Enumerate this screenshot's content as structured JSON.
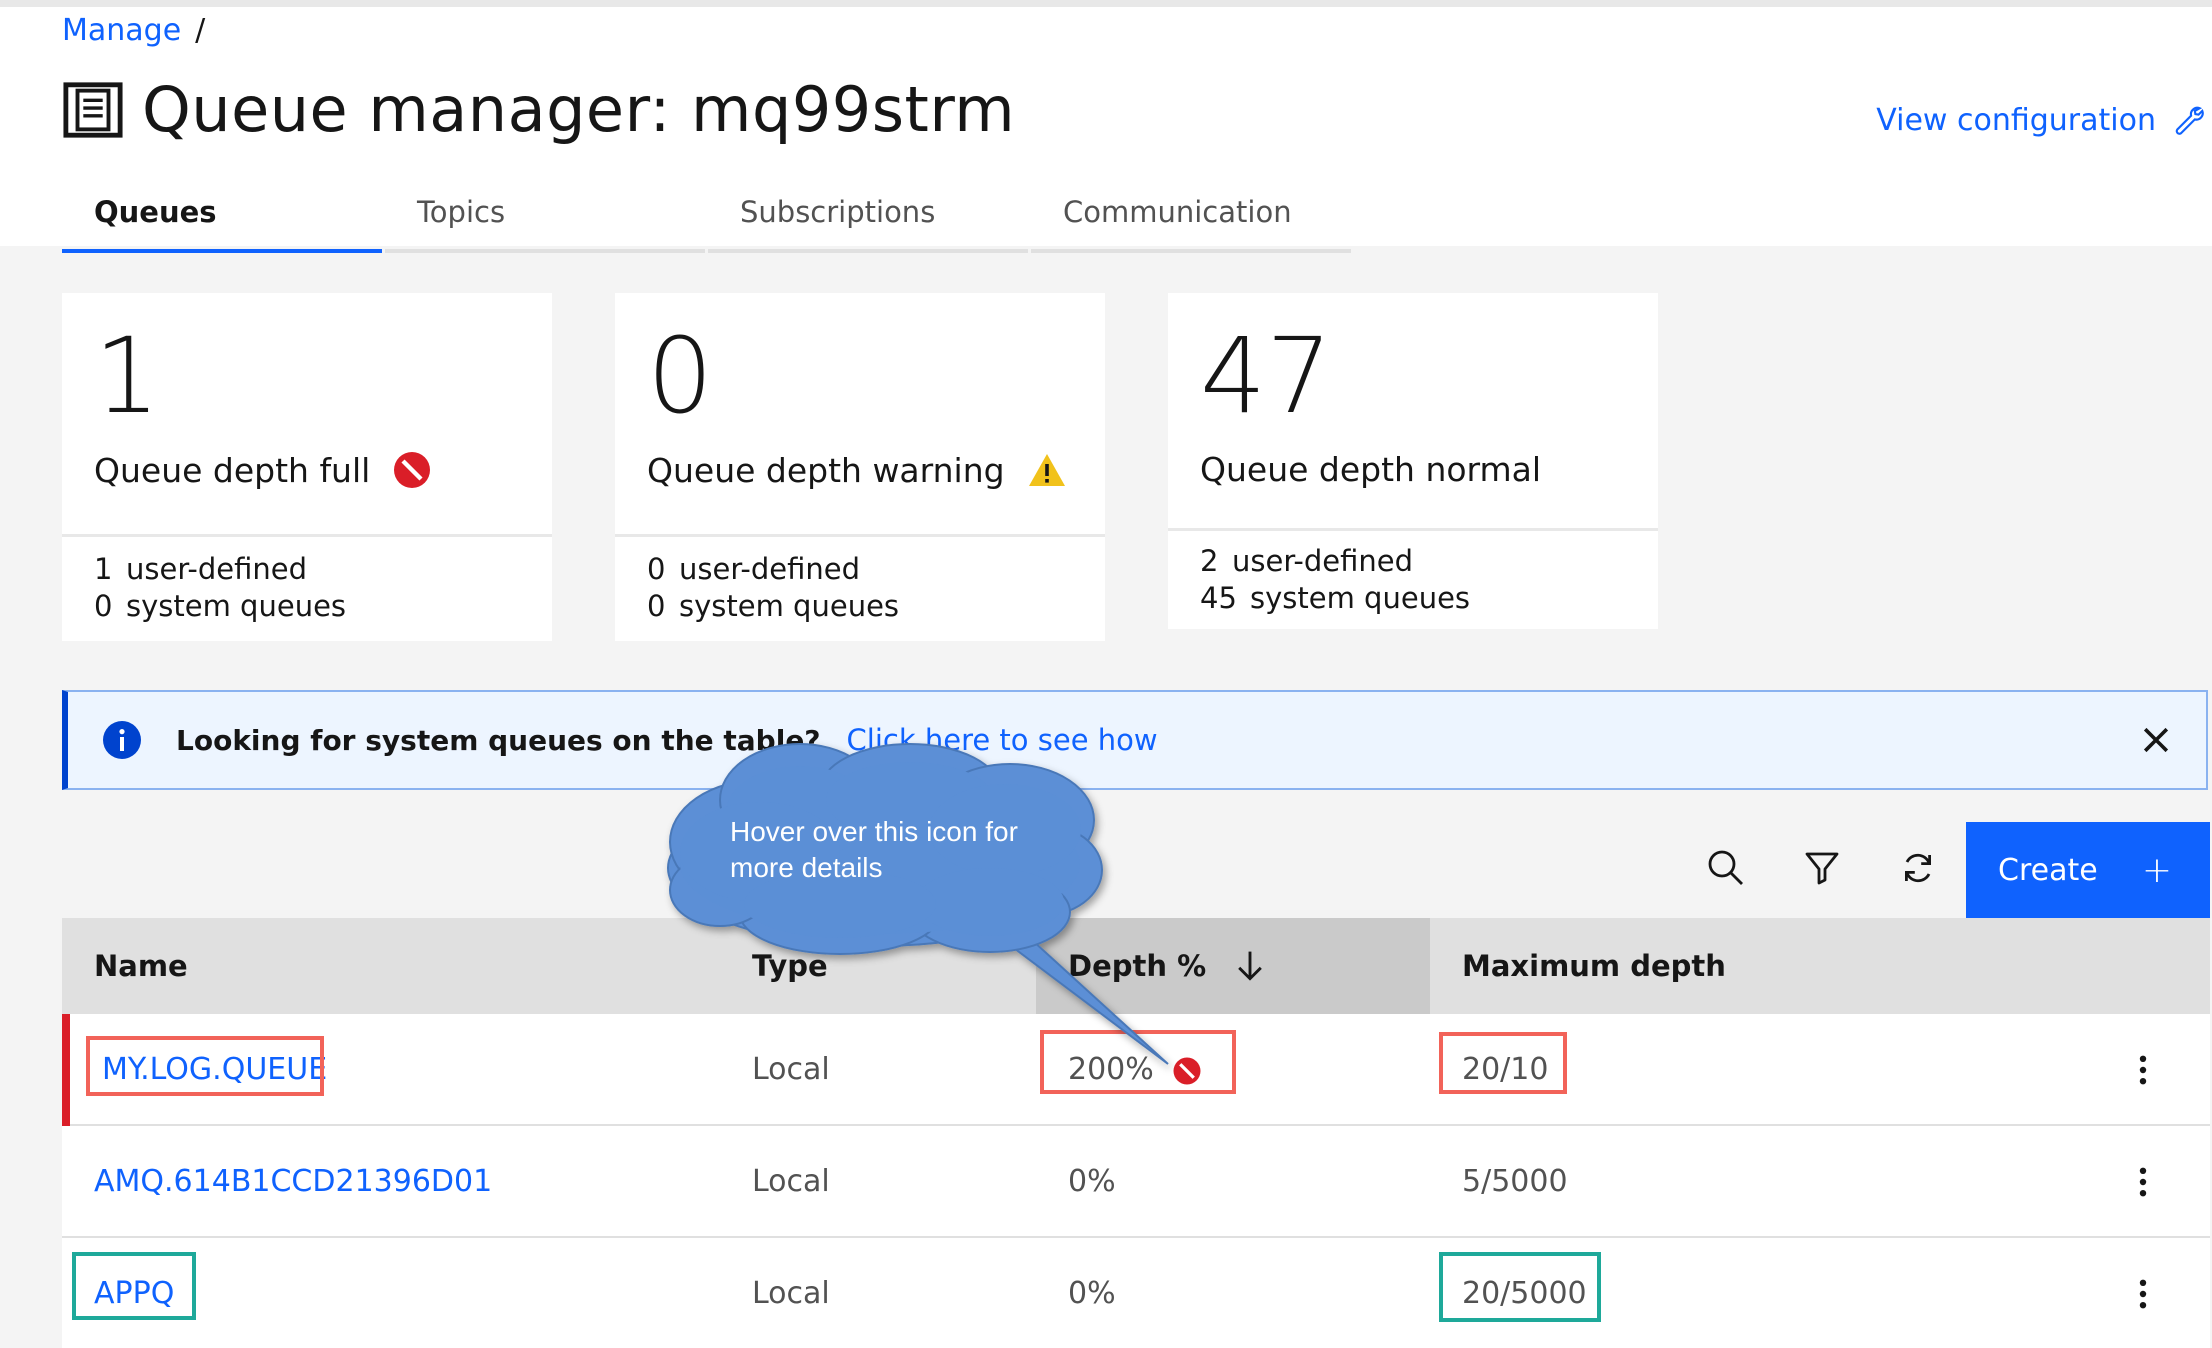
{
  "breadcrumb": {
    "parent": "Manage",
    "separator": "/"
  },
  "page": {
    "title": "Queue manager: mq99strm",
    "view_configuration": "View configuration"
  },
  "tabs": [
    {
      "label": "Queues",
      "active": true
    },
    {
      "label": "Topics",
      "active": false
    },
    {
      "label": "Subscriptions",
      "active": false
    },
    {
      "label": "Communication",
      "active": false
    }
  ],
  "tiles": [
    {
      "count": "1",
      "label": "Queue depth full",
      "status": "error",
      "user_defined": "1",
      "user_defined_label": "user-defined",
      "system": "0",
      "system_label": "system queues"
    },
    {
      "count": "0",
      "label": "Queue depth warning",
      "status": "warning",
      "user_defined": "0",
      "user_defined_label": "user-defined",
      "system": "0",
      "system_label": "system queues"
    },
    {
      "count": "47",
      "label": "Queue depth normal",
      "status": "normal",
      "user_defined": "2",
      "user_defined_label": "user-defined",
      "system": "45",
      "system_label": "system queues"
    }
  ],
  "notice": {
    "title": "Looking for system queues on the table?",
    "link": "Click here to see how"
  },
  "toolbar": {
    "create_label": "Create",
    "create_icon": "+"
  },
  "table": {
    "columns": [
      "Name",
      "Type",
      "Depth %",
      "Maximum depth"
    ],
    "sorted_column": "Depth %",
    "sort_direction": "descending",
    "rows": [
      {
        "name": "MY.LOG.QUEUE",
        "type": "Local",
        "depth": "200%",
        "max_depth": "20/10",
        "status": "error"
      },
      {
        "name": "AMQ.614B1CCD21396D01",
        "type": "Local",
        "depth": "0%",
        "max_depth": "5/5000",
        "status": "normal"
      },
      {
        "name": "APPQ",
        "type": "Local",
        "depth": "0%",
        "max_depth": "20/5000",
        "status": "normal"
      }
    ]
  },
  "callout": {
    "text": "Hover over this icon for more details"
  },
  "colors": {
    "accent": "#0f62fe",
    "error": "#da1e28",
    "warning": "#f1c21b",
    "annotation_red": "#f26359",
    "annotation_teal": "#1ea99a",
    "callout": "#5b8fd6"
  }
}
